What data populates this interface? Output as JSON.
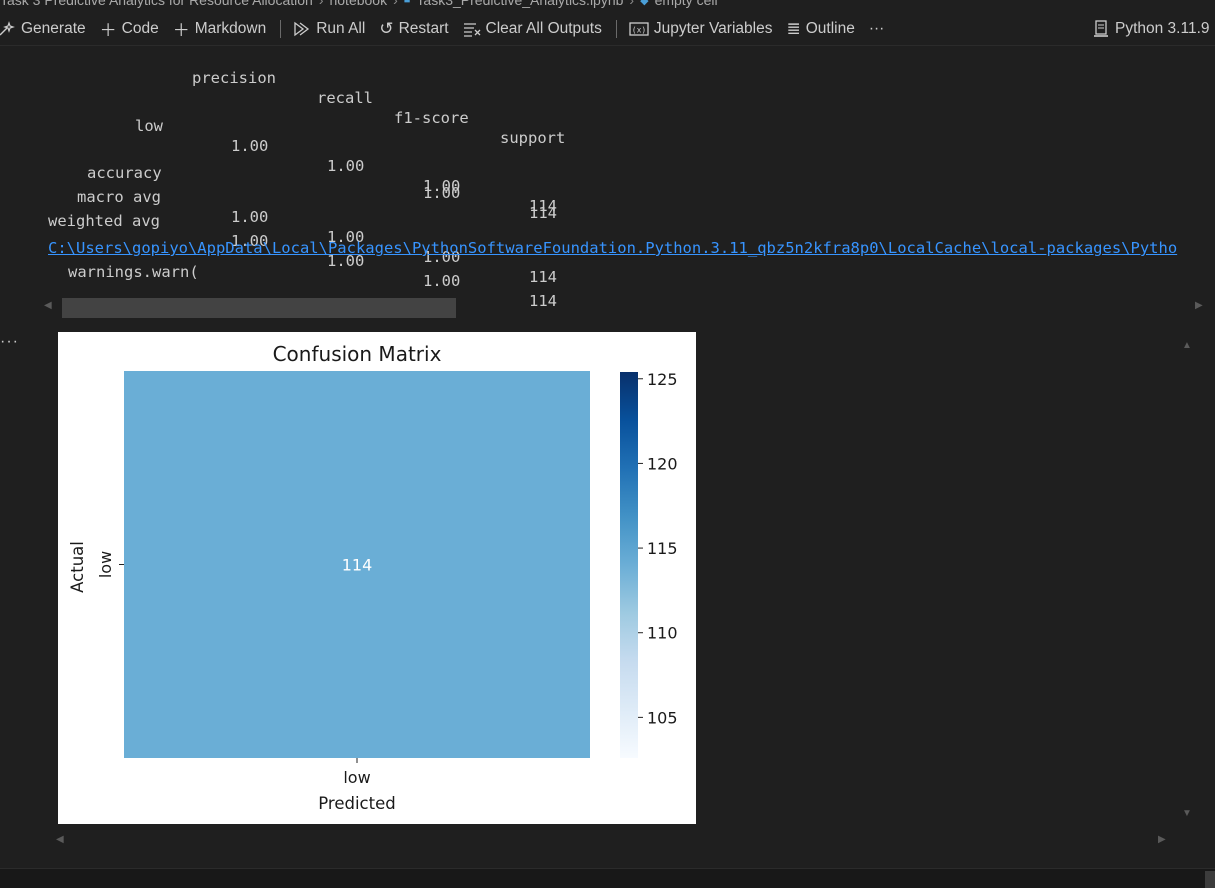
{
  "breadcrumb": {
    "items": [
      "Task 3 Predictive Analytics for Resource Allocation",
      "notebook",
      "Task3_Predictive_Analytics.ipynb",
      "empty cell"
    ]
  },
  "toolbar": {
    "generate": "Generate",
    "code": "Code",
    "markdown": "Markdown",
    "run_all": "Run All",
    "restart": "Restart",
    "clear_all": "Clear All Outputs",
    "variables": "Jupyter Variables",
    "outline": "Outline",
    "more": "···",
    "kernel": "Python 3.11.9"
  },
  "report": {
    "header": [
      "precision",
      "recall",
      "f1-score",
      "support"
    ],
    "rows": [
      {
        "label": "low",
        "precision": "1.00",
        "recall": "1.00",
        "f1": "1.00",
        "support": "114"
      },
      {
        "label": "accuracy",
        "precision": "",
        "recall": "",
        "f1": "1.00",
        "support": "114"
      },
      {
        "label": "macro avg",
        "precision": "1.00",
        "recall": "1.00",
        "f1": "1.00",
        "support": "114"
      },
      {
        "label": "weighted avg",
        "precision": "1.00",
        "recall": "1.00",
        "f1": "1.00",
        "support": "114"
      }
    ]
  },
  "warning": {
    "path": "C:\\Users\\gopiyo\\AppData\\Local\\Packages\\PythonSoftwareFoundation.Python.3.11_qbz5n2kfra8p0\\LocalCache\\local-packages\\Pytho",
    "code": "warnings.warn("
  },
  "cell_menu": "···",
  "chart_data": {
    "type": "heatmap",
    "title": "Confusion Matrix",
    "xlabel": "Predicted",
    "ylabel": "Actual",
    "x_categories": [
      "low"
    ],
    "y_categories": [
      "low"
    ],
    "values": [
      [
        114
      ]
    ],
    "colormap": "Blues",
    "colorbar": {
      "ticks": [
        105,
        110,
        115,
        120,
        125
      ],
      "range": [
        102.6,
        125.4
      ]
    },
    "cell_color": "#6aaed6"
  }
}
